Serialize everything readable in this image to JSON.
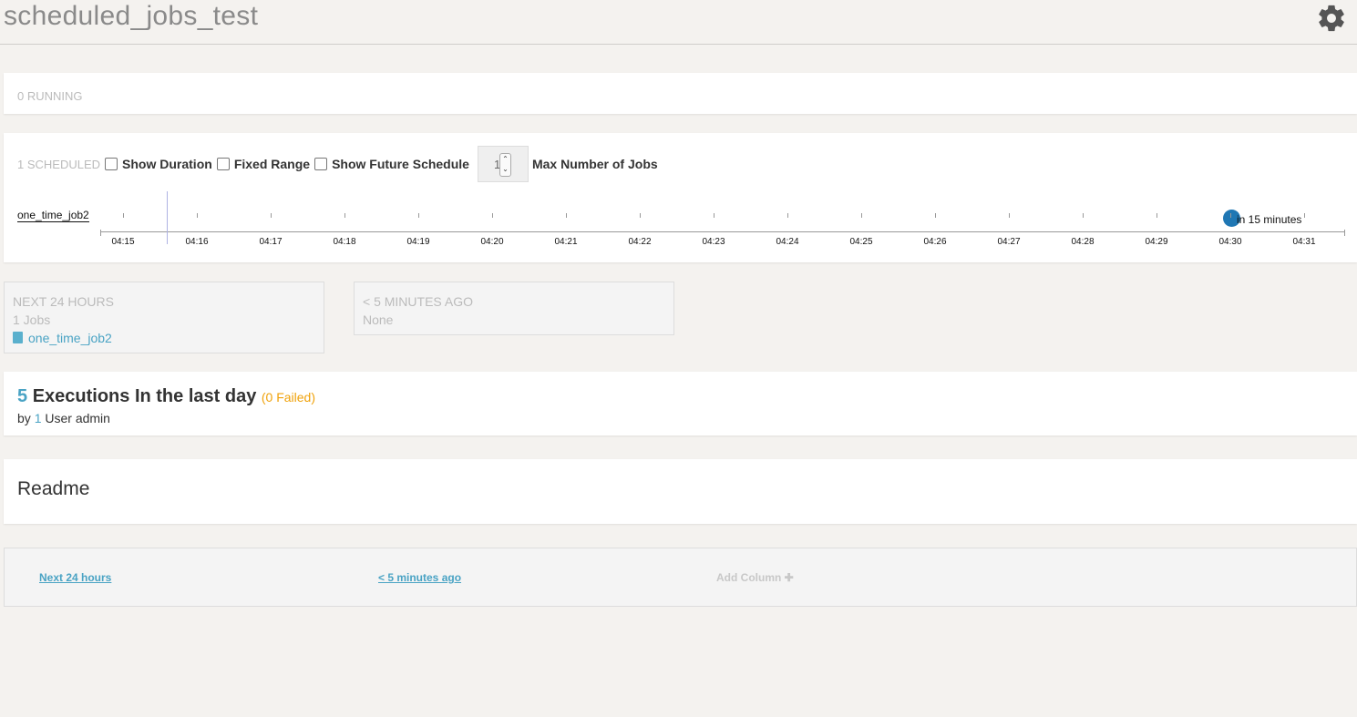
{
  "header": {
    "title": "scheduled_jobs_test",
    "settings_icon": "gear-icon"
  },
  "running": {
    "label": "0 RUNNING"
  },
  "scheduled": {
    "label": "1 SCHEDULED",
    "show_duration_label": "Show Duration",
    "fixed_range_label": "Fixed Range",
    "show_future_label": "Show Future Schedule",
    "max_jobs_value": "1",
    "max_jobs_label": "Max Number of Jobs",
    "show_duration_checked": false,
    "fixed_range_checked": false,
    "show_future_checked": false
  },
  "timeline": {
    "job_name": "one_time_job2",
    "ticks": [
      "04:15",
      "04:16",
      "04:17",
      "04:18",
      "04:19",
      "04:20",
      "04:21",
      "04:22",
      "04:23",
      "04:24",
      "04:25",
      "04:26",
      "04:27",
      "04:28",
      "04:29",
      "04:30",
      "04:31"
    ],
    "now": "04:15.6",
    "scheduled_at": "04:30",
    "scheduled_label": "in 15 minutes",
    "dot_color": "#1f77b4"
  },
  "next24": {
    "title": "NEXT 24 HOURS",
    "count": "1 Jobs",
    "job_link": "one_time_job2"
  },
  "recent": {
    "title": "< 5 MINUTES AGO",
    "value": "None"
  },
  "executions": {
    "count": "5",
    "text": "Executions In the last day",
    "failed": "(0 Failed)",
    "by": "by",
    "user_count": "1",
    "user_text": "User admin"
  },
  "readme": {
    "title": "Readme"
  },
  "footer": {
    "col1": "Next 24 hours",
    "col2": "< 5 minutes ago",
    "add_column": "Add Column"
  },
  "colors": {
    "accent": "#4aa3c4",
    "failed": "#f0a20b",
    "muted": "#bbbbbb"
  }
}
